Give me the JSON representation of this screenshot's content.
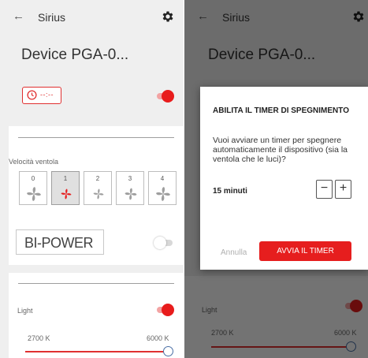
{
  "app": {
    "title": "Sirius",
    "back_icon": "arrow-left-icon",
    "settings_icon": "gear-icon"
  },
  "device": {
    "name": "Device PGA-0..."
  },
  "timer": {
    "icon": "clock-icon",
    "value": "--:--",
    "power_on": true
  },
  "fan": {
    "label": "Velocità ventola",
    "speeds": [
      "0",
      "1",
      "2",
      "3",
      "4"
    ],
    "selected": "1",
    "icon": "fan-icon"
  },
  "bipower": {
    "label": "BI-POWER",
    "on": false
  },
  "light": {
    "label": "Light",
    "on": true,
    "min_label": "2700 K",
    "max_label": "6000 K",
    "value_fraction": 1.0
  },
  "dialog": {
    "title": "ABILITA IL TIMER DI SPEGNIMENTO",
    "body": "Vuoi avviare un timer per spegnere automaticamente il dispositivo (sia la ventola che le luci)?",
    "duration": "15 minuti",
    "minus": "−",
    "plus": "+",
    "cancel": "Annulla",
    "confirm": "AVVIA IL TIMER"
  },
  "colors": {
    "accent": "#e61e1e",
    "background": "#efefef",
    "slider_thumb": "#4a6fa5"
  }
}
